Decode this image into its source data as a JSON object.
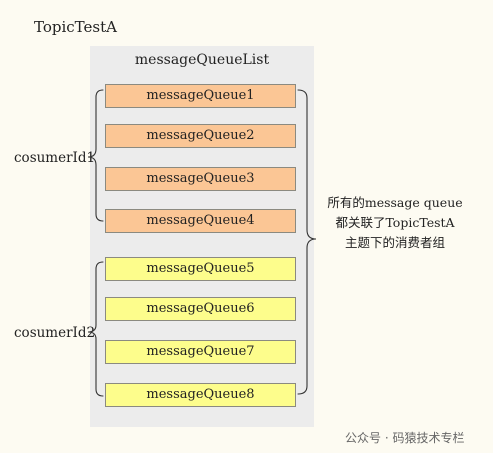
{
  "topic": "TopicTestA",
  "queue_list_title": "messageQueueList",
  "groups": [
    {
      "consumer": "cosumerId1",
      "queues": [
        "messageQueue1",
        "messageQueue2",
        "messageQueue3",
        "messageQueue4"
      ],
      "fill": "#fbc695"
    },
    {
      "consumer": "cosumerId2",
      "queues": [
        "messageQueue5",
        "messageQueue6",
        "messageQueue7",
        "messageQueue8"
      ],
      "fill": "#fdfd8c"
    }
  ],
  "note_lines": [
    "所有的message queue",
    "都关联了TopicTestA",
    "主题下的消费者组"
  ],
  "watermark": "公众号 · 码猿技术专栏"
}
